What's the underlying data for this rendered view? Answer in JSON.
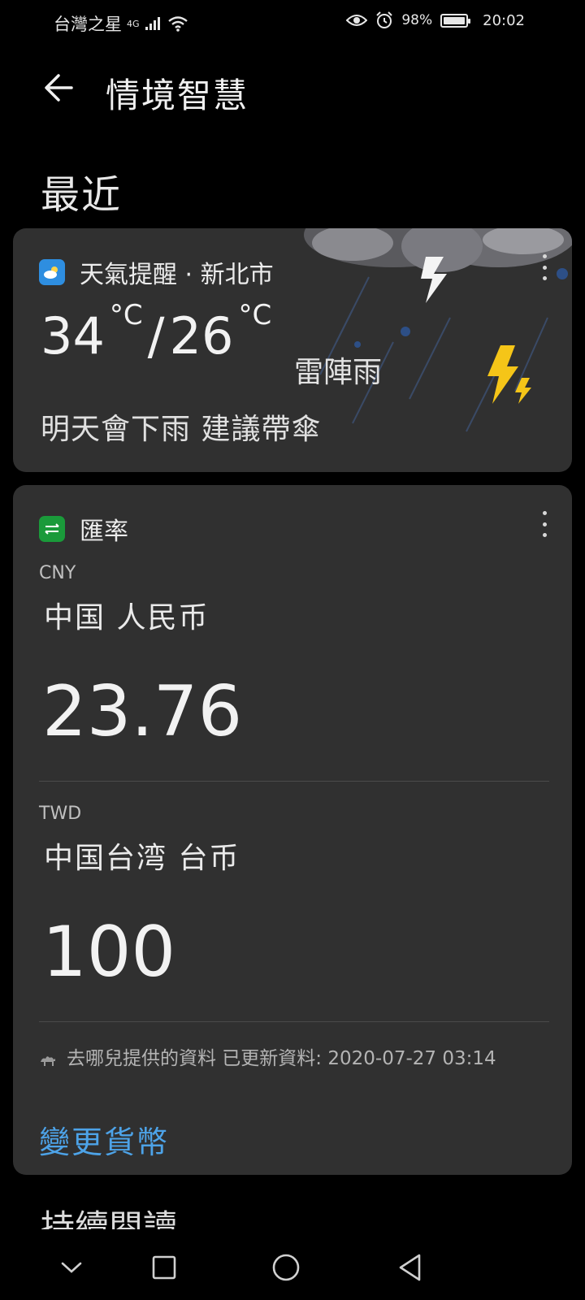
{
  "status_bar": {
    "carrier": "台灣之星",
    "network": "4G",
    "battery": "98%",
    "time": "20:02"
  },
  "header": {
    "title": "情境智慧"
  },
  "section": {
    "recent": "最近",
    "next_peek": "持續閱讀"
  },
  "weather": {
    "title": "天氣提醒 · 新北市",
    "high": "34",
    "low": "26",
    "unit": "°C",
    "condition": "雷陣雨",
    "advice": "明天會下雨 建議帶傘"
  },
  "exchange": {
    "title": "匯率",
    "from": {
      "code": "CNY",
      "name": "中国  人民币",
      "amount": "23.76"
    },
    "to": {
      "code": "TWD",
      "name": "中国台湾  台币",
      "amount": "100"
    },
    "source": "去哪兒提供的資料 已更新資料: 2020-07-27 03:14",
    "change_label": "變更貨幣"
  },
  "colors": {
    "accent": "#4da3e8",
    "card": "#303030",
    "weather_icon": "#2e8ee0",
    "fx_icon": "#1a9a3a",
    "bolt": "#f5c518"
  }
}
